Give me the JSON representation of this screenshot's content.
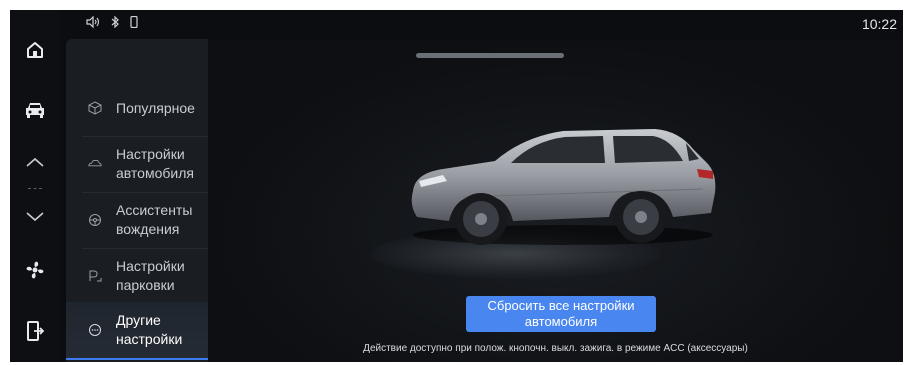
{
  "status_bar": {
    "time": "10:22",
    "icons": [
      "speaker-icon",
      "bluetooth-icon",
      "phone-icon"
    ]
  },
  "dock": {
    "items": [
      "home-icon",
      "car-icon",
      "chevron-up-icon",
      "chevron-down-icon",
      "fan-icon",
      "door-exit-icon"
    ]
  },
  "menu": {
    "items": [
      {
        "label": "Популярное",
        "icon": "cube-icon",
        "active": false
      },
      {
        "label": "Настройки\nавтомобиля",
        "icon": "car-outline-icon",
        "active": false
      },
      {
        "label": "Ассистенты\nвождения",
        "icon": "steering-wheel-icon",
        "active": false
      },
      {
        "label": "Настройки\nпарковки",
        "icon": "parking-icon",
        "active": false
      },
      {
        "label": "Другие\nнастройки",
        "icon": "more-icon",
        "active": true
      }
    ]
  },
  "content": {
    "reset_button": "Сбросить все настройки\nавтомобиля",
    "hint": "Действие доступно при полож. кнопочн. выкл. зажига. в режиме ACC (аксессуары)"
  },
  "colors": {
    "accent": "#4a86f0",
    "background": "#0b0d10",
    "menu_bg": "#1a1e23"
  }
}
